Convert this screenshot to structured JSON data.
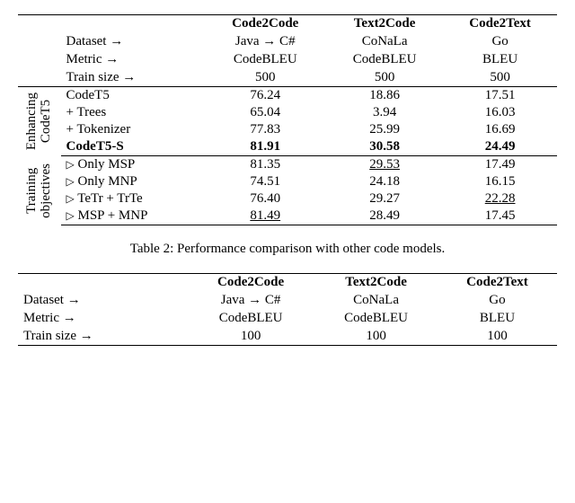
{
  "table1": {
    "header_labels": {
      "dataset": "Dataset",
      "metric": "Metric",
      "trainsize": "Train size",
      "arrow": "→"
    },
    "col_heads": {
      "c2c": "Code2Code",
      "t2c": "Text2Code",
      "c2t": "Code2Text"
    },
    "datasets": {
      "c2c": "Java → C#",
      "t2c": "CoNaLa",
      "c2t": "Go"
    },
    "metrics": {
      "c2c": "CodeBLEU",
      "t2c": "CodeBLEU",
      "c2t": "BLEU"
    },
    "trainsize": {
      "c2c": "500",
      "t2c": "500",
      "c2t": "500"
    },
    "groups": {
      "enhancing": {
        "l1": "Enhancing",
        "l2": "CodeT5"
      },
      "training": {
        "l1": "Training",
        "l2": "objectives"
      }
    },
    "rows_enh": [
      {
        "label": "CodeT5",
        "c2c": "76.24",
        "t2c": "18.86",
        "c2t": "17.51"
      },
      {
        "label": "+ Trees",
        "c2c": "65.04",
        "t2c": "3.94",
        "c2t": "16.03"
      },
      {
        "label": "+ Tokenizer",
        "c2c": "77.83",
        "t2c": "25.99",
        "c2t": "16.69"
      },
      {
        "label": "CodeT5-S",
        "c2c": "81.91",
        "t2c": "30.58",
        "c2t": "24.49",
        "bold": true
      }
    ],
    "rows_train": [
      {
        "label": "Only MSP",
        "c2c": "81.35",
        "t2c": "29.53",
        "t2c_u": true,
        "c2t": "17.49"
      },
      {
        "label": "Only MNP",
        "c2c": "74.51",
        "t2c": "24.18",
        "c2t": "16.15"
      },
      {
        "label": "TeTr + TrTe",
        "c2c": "76.40",
        "t2c": "29.27",
        "c2t": "22.28",
        "c2t_u": true
      },
      {
        "label": "MSP + MNP",
        "c2c": "81.49",
        "c2c_u": true,
        "t2c": "28.49",
        "c2t": "17.45"
      }
    ],
    "marker": "▷"
  },
  "caption2": "Table 2: Performance comparison with other code models.",
  "table2": {
    "header_labels": {
      "dataset": "Dataset",
      "metric": "Metric",
      "trainsize": "Train size",
      "arrow": "→"
    },
    "col_heads": {
      "c2c": "Code2Code",
      "t2c": "Text2Code",
      "c2t": "Code2Text"
    },
    "datasets": {
      "c2c": "Java → C#",
      "t2c": "CoNaLa",
      "c2t": "Go"
    },
    "metrics": {
      "c2c": "CodeBLEU",
      "t2c": "CodeBLEU",
      "c2t": "BLEU"
    },
    "trainsize": {
      "c2c": "100",
      "t2c": "100",
      "c2t": "100"
    }
  },
  "chart_data": [
    {
      "type": "table",
      "title": "Table 1 (upper): ablation/enhancement results",
      "row_groups": [
        "Enhancing CodeT5",
        "Training objectives"
      ],
      "columns": [
        "Code2Code (Java→C#, CodeBLEU, 500)",
        "Text2Code (CoNaLa, CodeBLEU, 500)",
        "Code2Text (Go, BLEU, 500)"
      ],
      "series": [
        {
          "name": "CodeT5",
          "values": [
            76.24,
            18.86,
            17.51
          ]
        },
        {
          "name": "+ Trees",
          "values": [
            65.04,
            3.94,
            16.03
          ]
        },
        {
          "name": "+ Tokenizer",
          "values": [
            77.83,
            25.99,
            16.69
          ]
        },
        {
          "name": "CodeT5-S",
          "values": [
            81.91,
            30.58,
            24.49
          ]
        },
        {
          "name": "Only MSP",
          "values": [
            81.35,
            29.53,
            17.49
          ]
        },
        {
          "name": "Only MNP",
          "values": [
            74.51,
            24.18,
            16.15
          ]
        },
        {
          "name": "TeTr + TrTe",
          "values": [
            76.4,
            29.27,
            22.28
          ]
        },
        {
          "name": "MSP + MNP",
          "values": [
            81.49,
            28.49,
            17.45
          ]
        }
      ]
    },
    {
      "type": "table",
      "title": "Table 2 header (lower, partially visible)",
      "columns": [
        "Code2Code (Java→C#, CodeBLEU, 100)",
        "Text2Code (CoNaLa, CodeBLEU, 100)",
        "Code2Text (Go, BLEU, 100)"
      ]
    }
  ]
}
